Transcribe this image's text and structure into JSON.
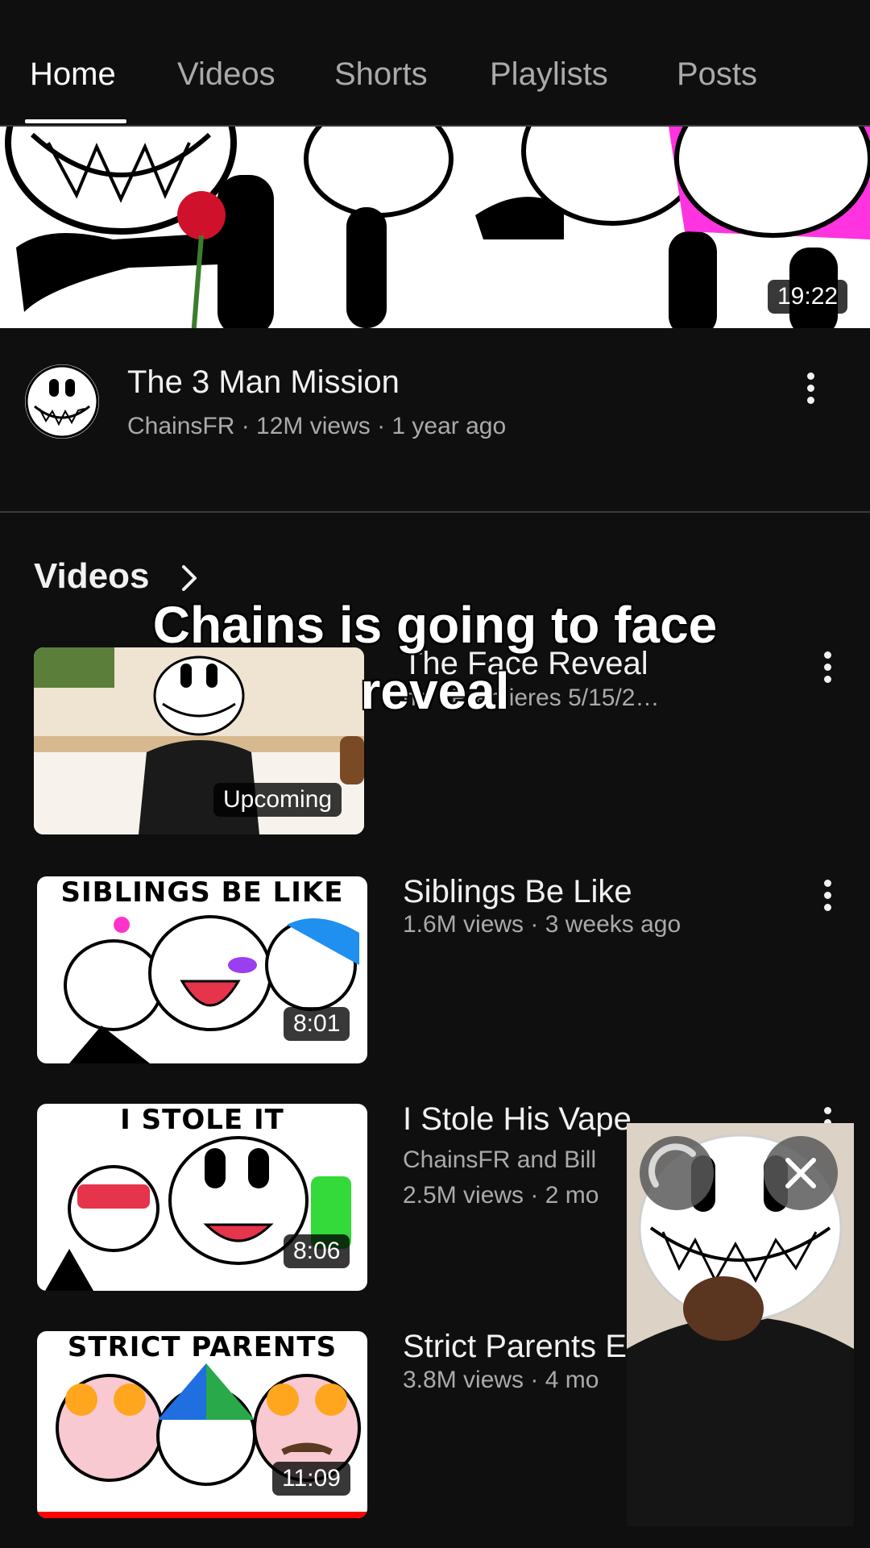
{
  "tabs": [
    {
      "label": "Home",
      "active": true
    },
    {
      "label": "Videos",
      "active": false
    },
    {
      "label": "Shorts",
      "active": false
    },
    {
      "label": "Playlists",
      "active": false
    },
    {
      "label": "Posts",
      "active": false
    }
  ],
  "featured": {
    "duration": "19:22",
    "title": "The 3 Man Mission",
    "meta": "ChainsFR · 12M views · 1 year ago"
  },
  "videos_section": {
    "title": "Videos",
    "items": [
      {
        "title": "The Face Reveal",
        "meta": "ng · Premieres 5/15/2…",
        "badge": "Upcoming"
      },
      {
        "banner": "SIBLINGS BE LIKE",
        "title": "Siblings Be Like",
        "meta": "1.6M views · 3 weeks ago",
        "duration": "8:01"
      },
      {
        "banner": "I STOLE IT",
        "title": "I Stole His Vape",
        "meta1": "ChainsFR and Bill",
        "meta2": "2.5M views · 2 mo",
        "duration": "8:06"
      },
      {
        "banner": "STRICT PARENTS",
        "title": "Strict Parents E",
        "meta": "3.8M views · 4 mo",
        "duration": "11:09"
      }
    ]
  },
  "caption_overlay": {
    "line1": "Chains is going to face",
    "line2": "reveal"
  },
  "colors": {
    "background": "#0f0f0f",
    "text_primary": "#f1f1f1",
    "text_secondary": "#aaaaaa",
    "accent_red": "#ff0000"
  }
}
